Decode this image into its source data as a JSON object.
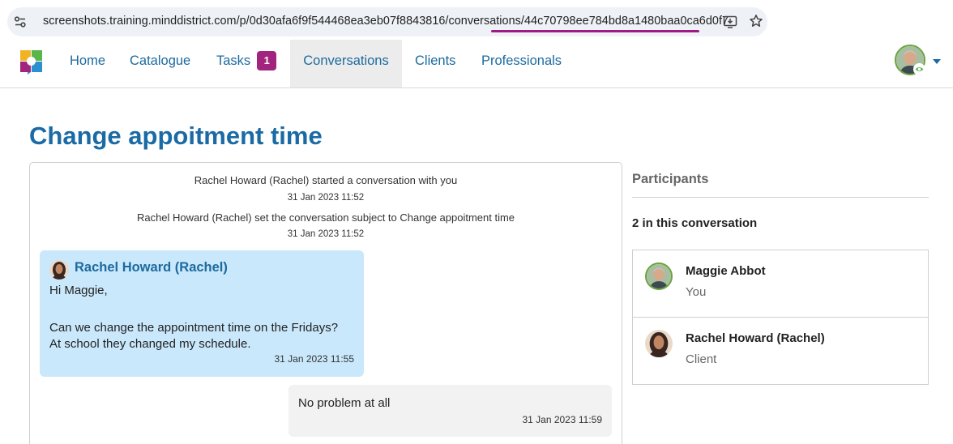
{
  "browser": {
    "url_prefix": "screenshots.training.minddistrict.com/p/0d30afa6f9f544468ea3eb07f8843816/conversations",
    "url_highlight": "/44c70798ee784bd8a1480baa0ca6d0f7",
    "highlight_color": "#a01a86"
  },
  "nav": {
    "items": [
      {
        "label": "Home"
      },
      {
        "label": "Catalogue"
      },
      {
        "label": "Tasks",
        "badge": "1"
      },
      {
        "label": "Conversations",
        "active": true
      },
      {
        "label": "Clients"
      },
      {
        "label": "Professionals"
      }
    ],
    "accent": "#1c6a9e",
    "badge_color": "#a3247e"
  },
  "page": {
    "title": "Change appoitment time"
  },
  "conversation": {
    "system_events": [
      {
        "text": "Rachel Howard (Rachel) started a conversation with you",
        "time": "31 Jan 2023 11:52"
      },
      {
        "text": "Rachel Howard (Rachel) set the conversation subject to Change appoitment time",
        "time": "31 Jan 2023 11:52"
      }
    ],
    "messages": [
      {
        "sender": "Rachel Howard (Rachel)",
        "lines": [
          "Hi Maggie,",
          "",
          "Can we change the appointment time on the Fridays?",
          "At school they changed my schedule."
        ],
        "time": "31 Jan 2023 11:55",
        "direction": "incoming"
      },
      {
        "sender": "",
        "lines": [
          "No problem at all"
        ],
        "time": "31 Jan 2023 11:59",
        "direction": "outgoing"
      }
    ]
  },
  "participants": {
    "heading": "Participants",
    "count_label": "2 in this conversation",
    "list": [
      {
        "name": "Maggie Abbot",
        "role": "You"
      },
      {
        "name": "Rachel Howard (Rachel)",
        "role": "Client"
      }
    ]
  }
}
